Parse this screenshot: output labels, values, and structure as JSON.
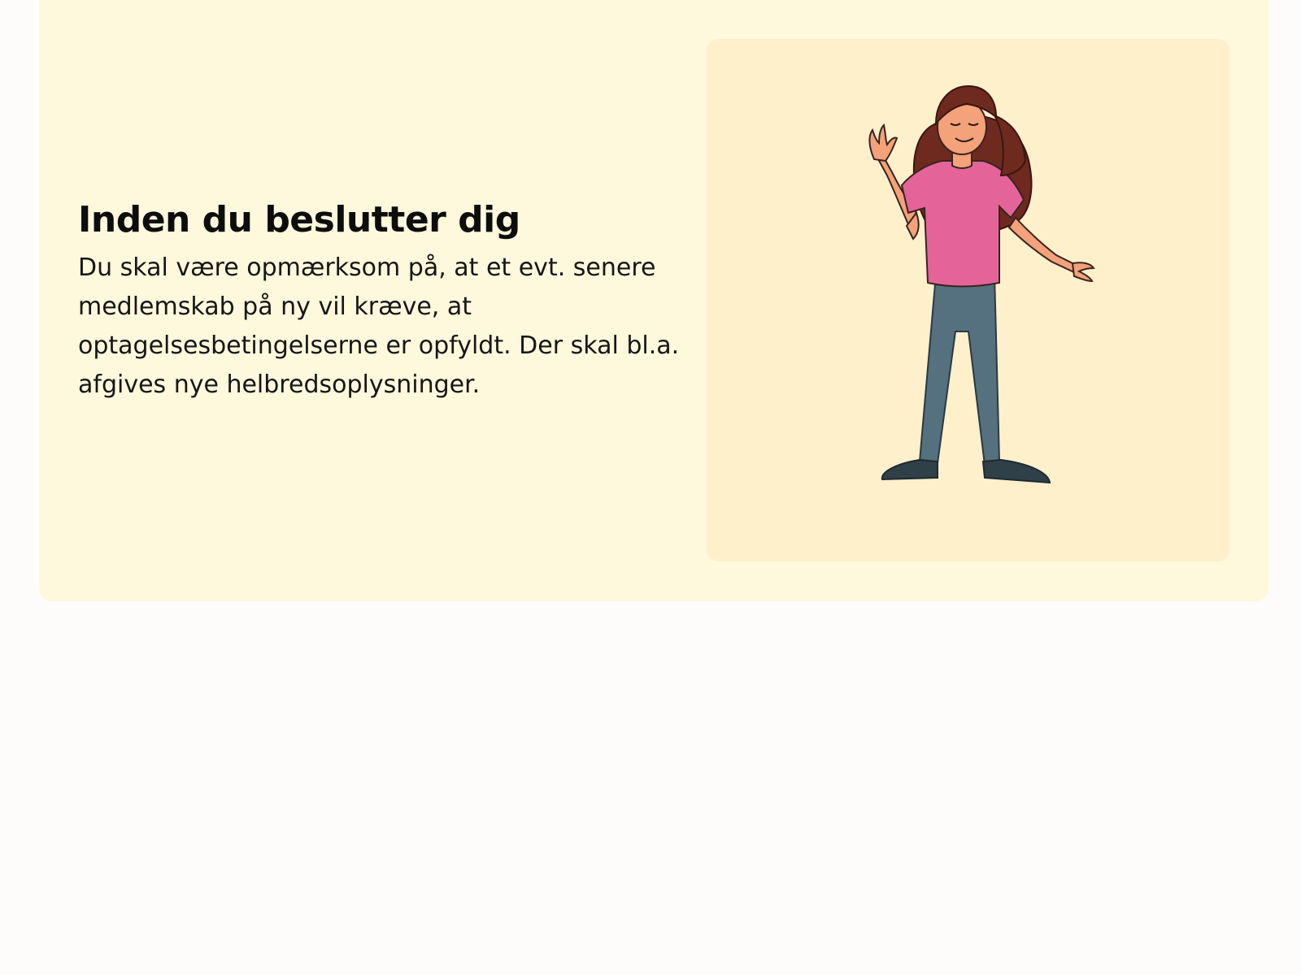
{
  "section": {
    "title": "Inden du beslutter dig",
    "body": "Du skal være opmærksom på, at et evt. senere medlemskab på ny vil kræve, at optagelsesbetingelserne er opfyldt. Der skal bl.a. afgives nye helbredsoplysninger."
  },
  "illustration": {
    "icon": "waving-woman-illustration",
    "colors": {
      "card_background": "#fef8dc",
      "image_background": "#fff0cc",
      "hair": "#6e2a1f",
      "shirt": "#e4649a",
      "pants": "#55707e",
      "skin": "#f3a27a",
      "shoes": "#2f4048"
    }
  }
}
